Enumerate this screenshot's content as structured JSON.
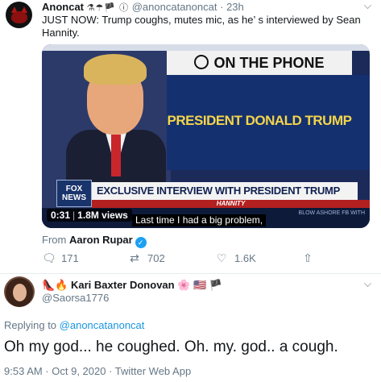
{
  "tweet": {
    "author_name": "Anoncat",
    "author_emojis": "⚗☂🏴 ⓘ",
    "author_handle": "@anoncatanoncat",
    "time_sep": "·",
    "time": "23h",
    "text": "JUST NOW: Trump coughs, mutes mic, as he’  s interviewed by Sean Hannity.",
    "video": {
      "banner_top": "ON THE PHONE",
      "banner_name": "PRESIDENT DONALD TRUMP",
      "channel_logo": "FOX NEWS",
      "lower_third": "EXCLUSIVE INTERVIEW WITH PRESIDENT TRUMP",
      "show_name": "HANNITY",
      "ticker_text": "BLOW ASHORE FB WITH",
      "duration": "0:31",
      "views": "1.8M views",
      "caption": "Last time I had a big problem,"
    },
    "from_label": "From",
    "from_name": "Aaron Rupar",
    "actions": {
      "reply_count": "171",
      "retweet_count": "702",
      "like_count": "1.6K"
    }
  },
  "reply": {
    "author_emojis": "👠🔥",
    "author_name": "Kari Baxter Donovan",
    "author_flags": "🌸 🇺🇸 🏴",
    "author_handle": "@Saorsa1776",
    "replying_label": "Replying to",
    "replying_to": "@anoncatanoncat",
    "text": "Oh my god... he coughed. Oh. my.  god.. a cough.",
    "timestamp": "9:53 AM · Oct 9, 2020 · Twitter Web App"
  },
  "colors": {
    "link_blue": "#1b95e0",
    "muted_gray": "#657786",
    "text_dark": "#14171a",
    "verified_blue": "#1da1f2"
  },
  "icons": {
    "reply": "comment-icon",
    "retweet": "retweet-icon",
    "like": "heart-icon",
    "share": "share-icon",
    "menu": "chevron-down-icon"
  }
}
